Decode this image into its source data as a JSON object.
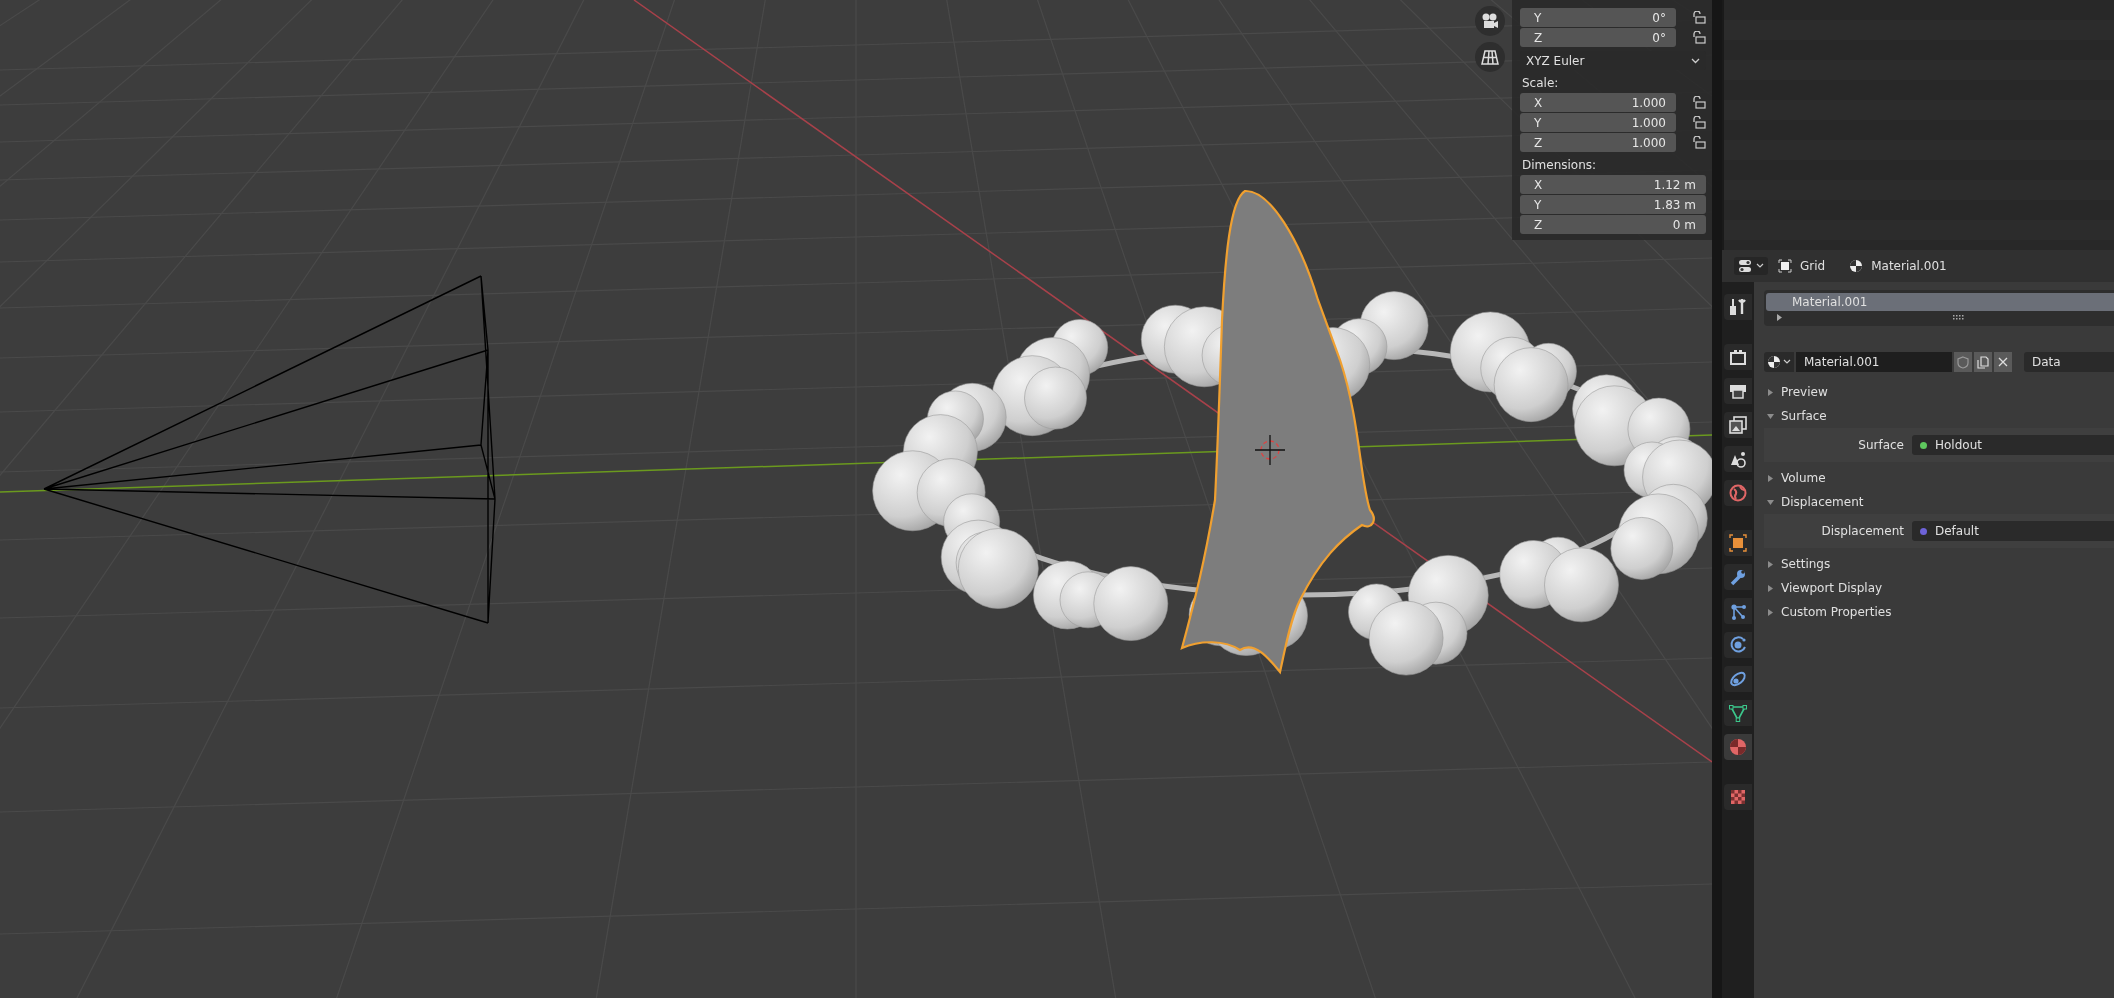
{
  "viewport": {
    "n_panel": {
      "rotation_rows": [
        {
          "axis": "Y",
          "value": "0°"
        },
        {
          "axis": "Z",
          "value": "0°"
        }
      ],
      "rotation_mode": "XYZ Euler",
      "scale": {
        "label": "Scale:",
        "rows": [
          {
            "axis": "X",
            "value": "1.000"
          },
          {
            "axis": "Y",
            "value": "1.000"
          },
          {
            "axis": "Z",
            "value": "1.000"
          }
        ]
      },
      "dimensions": {
        "label": "Dimensions:",
        "rows": [
          {
            "axis": "X",
            "value": "1.12 m"
          },
          {
            "axis": "Y",
            "value": "1.83 m"
          },
          {
            "axis": "Z",
            "value": "0 m"
          }
        ]
      }
    }
  },
  "properties": {
    "header": {
      "object": "Grid",
      "material": "Material.001"
    },
    "tabs": [
      {
        "kind": "tool",
        "selected": false
      },
      {
        "kind": "render",
        "selected": false
      },
      {
        "kind": "output",
        "selected": false
      },
      {
        "kind": "view_layer",
        "selected": false
      },
      {
        "kind": "scene",
        "selected": false
      },
      {
        "kind": "world",
        "selected": false
      },
      {
        "kind": "object",
        "selected": false
      },
      {
        "kind": "modifiers",
        "selected": false
      },
      {
        "kind": "particles",
        "selected": false
      },
      {
        "kind": "physics",
        "selected": false
      },
      {
        "kind": "constraints",
        "selected": false
      },
      {
        "kind": "data",
        "selected": false
      },
      {
        "kind": "material",
        "selected": true
      },
      {
        "kind": "texture",
        "selected": false
      }
    ],
    "slots": [
      {
        "name": "Material.001",
        "selected": true
      }
    ],
    "material_field": "Material.001",
    "link_mode": "Data",
    "sections": [
      {
        "title": "Preview",
        "expanded": false
      },
      {
        "title": "Surface",
        "expanded": true,
        "fields": [
          {
            "label": "Surface",
            "value": "Holdout",
            "color": "#5ec85e"
          }
        ]
      },
      {
        "title": "Volume",
        "expanded": false
      },
      {
        "title": "Displacement",
        "expanded": true,
        "fields": [
          {
            "label": "Displacement",
            "value": "Default",
            "color": "#6e63d9"
          }
        ]
      },
      {
        "title": "Settings",
        "expanded": false
      },
      {
        "title": "Viewport Display",
        "expanded": false
      },
      {
        "title": "Custom Properties",
        "expanded": false
      }
    ]
  }
}
